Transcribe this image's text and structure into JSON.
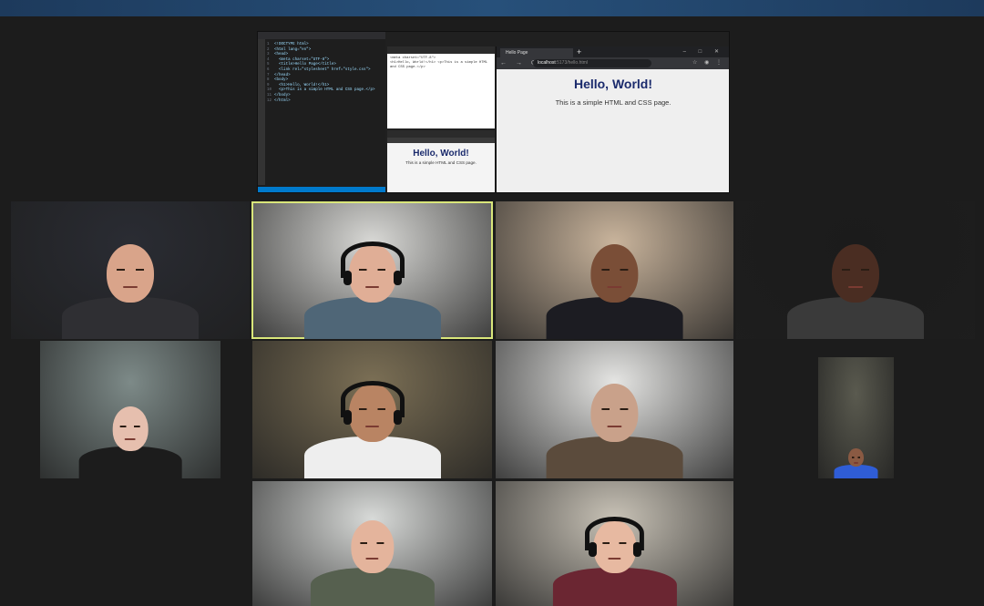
{
  "shared_screen": {
    "browser_tab_title": "Hello Page",
    "url_host": "localhost",
    "url_path": ":5173/hello.html",
    "page_heading": "Hello, World!",
    "page_text": "This is a simple HTML and CSS page.",
    "preview_heading": "Hello, World!",
    "preview_text": "This is a simple HTML and CSS page.",
    "source_preview_line1": "<meta charset=\"UTF-8\">",
    "source_preview_line2": "<h1>Hello, World!</h1> <p>This is a simple HTML and CSS page.</p>"
  },
  "code_lines": [
    "<!DOCTYPE html>",
    "<html lang=\"en\">",
    "<head>",
    "  <meta charset=\"UTF-8\">",
    "  <title>Hello Page</title>",
    "  <link rel=\"stylesheet\" href=\"style.css\">",
    "</head>",
    "<body>",
    "  <h1>Hello, World!</h1>",
    "  <p>This is a simple HTML and CSS page.</p>",
    "</body>",
    "</html>"
  ],
  "participants": [
    {
      "id": "p1",
      "bg": "#2a2c33",
      "skin": "#d9a48a",
      "shirt": "#2f2f33",
      "headset": false
    },
    {
      "id": "p2",
      "bg": "#d9d9d6",
      "skin": "#e0ae96",
      "shirt": "#4f6677",
      "headset": true,
      "active": true
    },
    {
      "id": "p3",
      "bg": "#c9b49c",
      "skin": "#7a4e37",
      "shirt": "#1c1c22",
      "headset": false
    },
    {
      "id": "p4",
      "bg": "#1b1b1b",
      "skin": "#4a2d22",
      "shirt": "#3a3a3a",
      "headset": false
    },
    {
      "id": "p5",
      "bg": "#7d8a88",
      "skin": "#e6bfae",
      "shirt": "#1c1c1c",
      "headset": false
    },
    {
      "id": "p6",
      "bg": "#7b6f55",
      "skin": "#b98463",
      "shirt": "#eeeeee",
      "headset": true
    },
    {
      "id": "p7",
      "bg": "#e5e5e3",
      "skin": "#c9a18a",
      "shirt": "#5b4b3c",
      "headset": false
    },
    {
      "id": "p8",
      "bg": "#5a5a4f",
      "skin": "#8a5a43",
      "shirt": "#2f5dd6",
      "headset": false
    },
    {
      "id": "p9",
      "bg": "#d8dad8",
      "skin": "#e4b49c",
      "shirt": "#56604f",
      "headset": false
    },
    {
      "id": "p10",
      "bg": "#c8c2b6",
      "skin": "#e7b9a1",
      "shirt": "#6b2632",
      "headset": true
    }
  ]
}
